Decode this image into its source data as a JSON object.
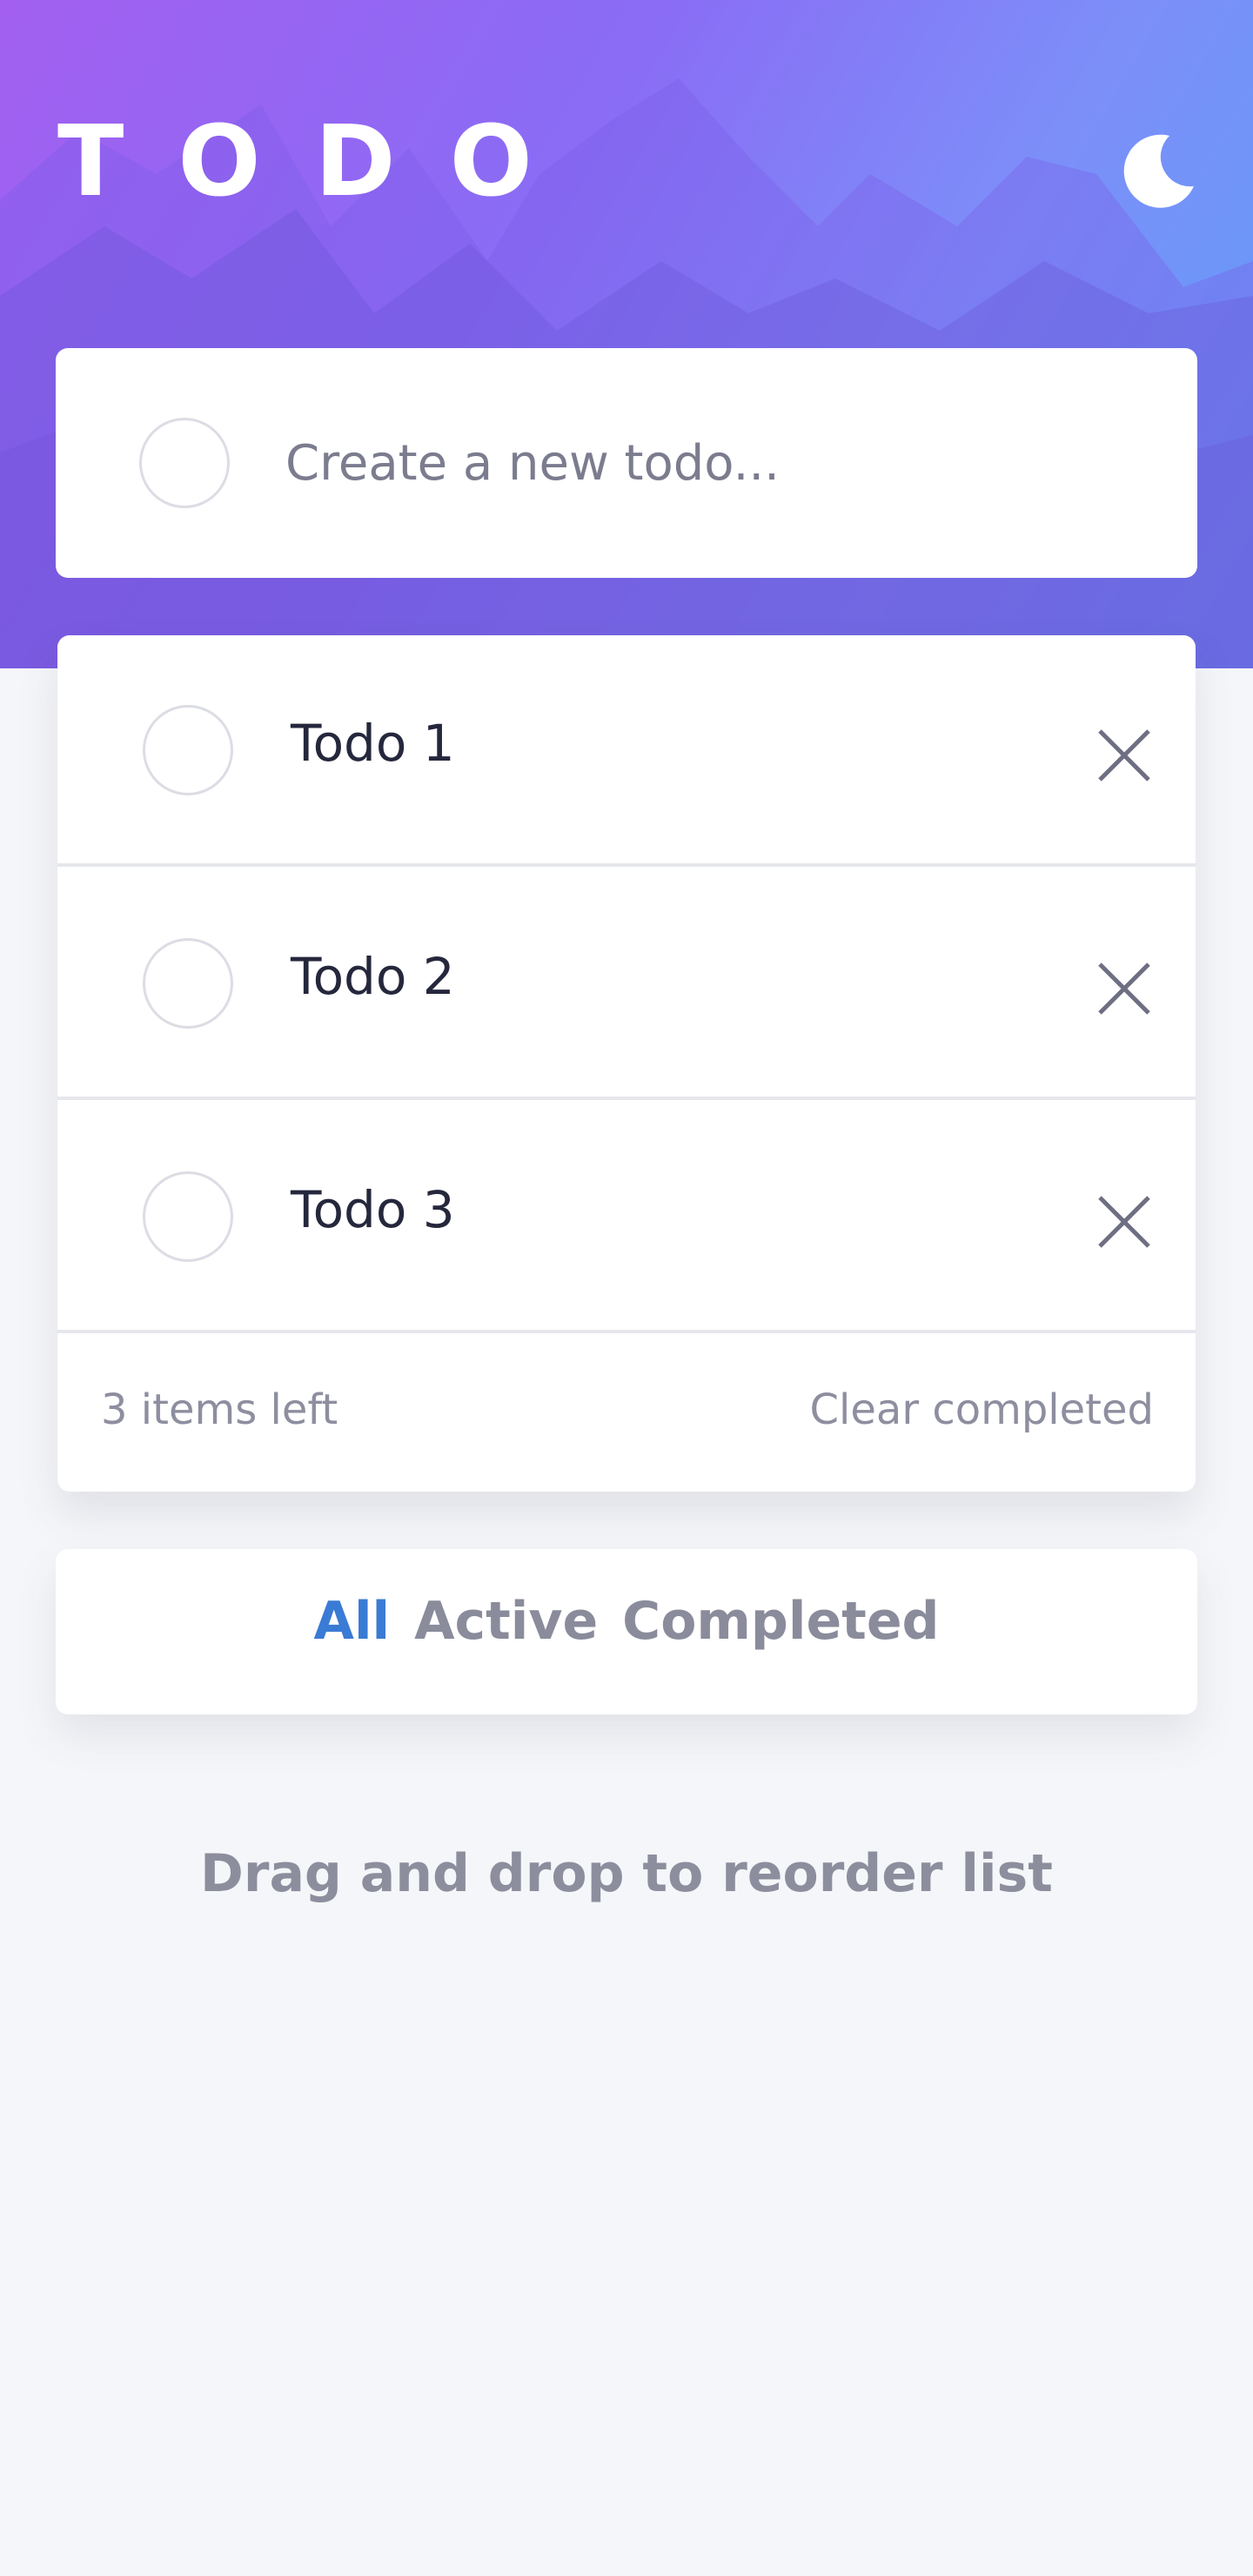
{
  "header": {
    "title": "TODO",
    "theme_icon": "moon-icon"
  },
  "new_todo": {
    "placeholder": "Create a new todo..."
  },
  "todos": [
    {
      "text": "Todo 1",
      "completed": false
    },
    {
      "text": "Todo 2",
      "completed": false
    },
    {
      "text": "Todo 3",
      "completed": false
    }
  ],
  "footer": {
    "items_left": "3 items left",
    "clear_completed": "Clear completed"
  },
  "filters": {
    "all": "All",
    "active": "Active",
    "completed": "Completed",
    "selected": "All"
  },
  "hint": "Drag and drop to reorder list",
  "colors": {
    "accent": "#3a7bd5",
    "hero_start": "#a25ff0",
    "hero_end": "#5f9df7",
    "background": "#f5f6f9"
  }
}
